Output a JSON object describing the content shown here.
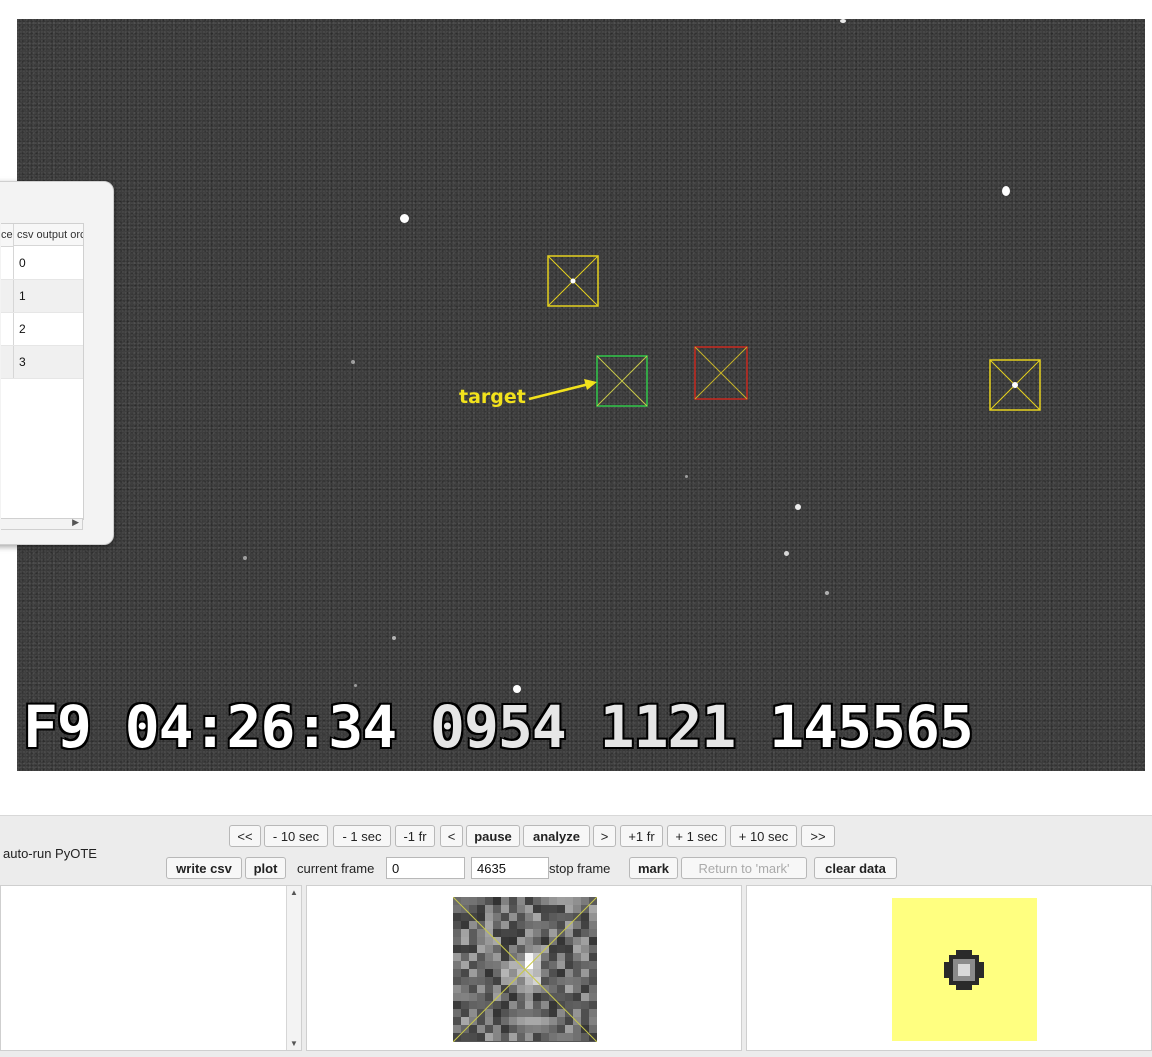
{
  "video": {
    "target_label": "target",
    "timestamp": {
      "field": "F9",
      "time": "04:26:34",
      "ms": "0954",
      "frac": "1121",
      "count": "145565"
    },
    "aperture_colors": {
      "reference": "#e6d21e",
      "target": "#31c94a",
      "excluded": "#c8281e"
    }
  },
  "side_table": {
    "headers": [
      "ce",
      "csv output orc"
    ],
    "rows": [
      "0",
      "1",
      "2",
      "3"
    ]
  },
  "controls": {
    "auto_run_label": "auto-run PyOTE",
    "nav": [
      "<<",
      "- 10 sec",
      "- 1 sec",
      "-1 fr",
      "<",
      "pause",
      "analyze",
      ">",
      "+1 fr",
      "+ 1 sec",
      "+ 10 sec",
      ">>"
    ],
    "write_csv": "write csv",
    "plot": "plot",
    "current_frame_label": "current frame",
    "current_frame_value": "0",
    "stop_frame_value": "4635",
    "stop_frame_label": "stop frame",
    "mark": "mark",
    "return_to_mark": "Return to 'mark'",
    "clear_data": "clear data"
  },
  "mask_color": "#ffff80"
}
